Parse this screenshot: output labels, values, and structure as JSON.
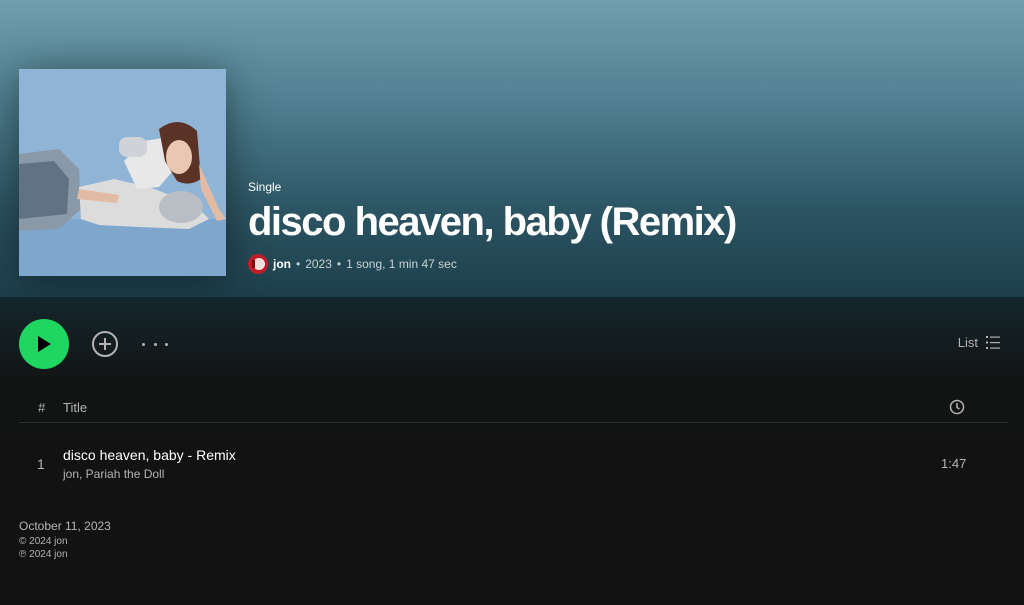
{
  "header": {
    "type_label": "Single",
    "title": "disco heaven, baby (Remix)",
    "artist": "jon",
    "separator": "•",
    "year": "2023",
    "summary": "1 song, 1 min 47 sec"
  },
  "cover": {
    "icon": "album-cover-image"
  },
  "actions": {
    "play_icon": "play-icon",
    "add_icon": "add-circle-icon",
    "more_icon": "more-options-icon",
    "view_label": "List",
    "view_icon": "list-icon"
  },
  "table": {
    "columns": {
      "number": "#",
      "title": "Title",
      "duration_icon": "clock-icon"
    },
    "tracks": [
      {
        "number": "1",
        "title": "disco heaven, baby - Remix",
        "artists": "jon, Pariah the Doll",
        "duration": "1:47"
      }
    ]
  },
  "footer": {
    "release_date": "October 11, 2023",
    "copyright": "© 2024 jon",
    "phonographic": "℗ 2024 jon"
  },
  "colors": {
    "accent": "#1ed760",
    "hero_top": "#6f9eae",
    "hero_bottom": "#1d3f4b",
    "background": "#121212",
    "secondary_text": "#b3b3b3"
  }
}
